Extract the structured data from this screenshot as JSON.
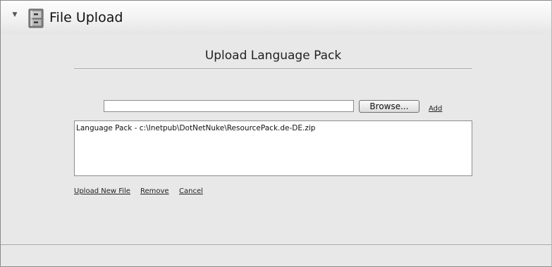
{
  "header": {
    "title": "File Upload",
    "toggle_icon": "collapse-triangle-icon",
    "module_icon": "file-cabinet-icon"
  },
  "section": {
    "title": "Upload Language Pack"
  },
  "upload_form": {
    "file_input_value": "",
    "browse_label": "Browse...",
    "add_label": "Add"
  },
  "file_list": {
    "items": [
      "Language Pack - c:\\Inetpub\\DotNetNuke\\ResourcePack.de-DE.zip"
    ]
  },
  "actions": {
    "upload_new_file_label": "Upload New File",
    "remove_label": "Remove",
    "cancel_label": "Cancel"
  }
}
